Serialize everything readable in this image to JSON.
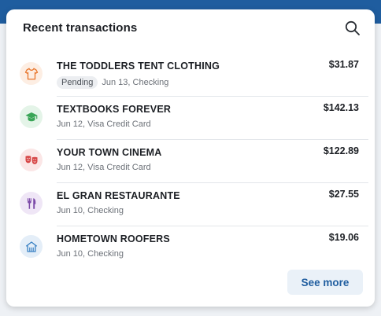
{
  "card": {
    "title": "Recent transactions"
  },
  "colors": {
    "header_band": "#1f5d9f",
    "accent": "#1f5d9f"
  },
  "transactions": [
    {
      "merchant": "THE TODDLERS TENT CLOTHING",
      "amount": "$31.87",
      "status": "Pending",
      "detail": "Jun 13, Checking",
      "icon": "tshirt-icon",
      "icon_color": "#e8772e",
      "icon_bg": "#fdeee3"
    },
    {
      "merchant": "TEXTBOOKS FOREVER",
      "amount": "$142.13",
      "detail": "Jun 12, Visa Credit Card",
      "icon": "graduation-cap-icon",
      "icon_color": "#3aa557",
      "icon_bg": "#e4f4e8"
    },
    {
      "merchant": "YOUR TOWN CINEMA",
      "amount": "$122.89",
      "detail": "Jun 12, Visa Credit Card",
      "icon": "theater-masks-icon",
      "icon_color": "#d64545",
      "icon_bg": "#fbe6e6"
    },
    {
      "merchant": "EL GRAN RESTAURANTE",
      "amount": "$27.55",
      "detail": "Jun 10, Checking",
      "icon": "utensils-icon",
      "icon_color": "#7c4aa8",
      "icon_bg": "#efe6f6"
    },
    {
      "merchant": "HOMETOWN ROOFERS",
      "amount": "$19.06",
      "detail": "Jun 10, Checking",
      "icon": "house-icon",
      "icon_color": "#3b82c4",
      "icon_bg": "#e4eef8"
    }
  ],
  "footer": {
    "see_more_label": "See more"
  }
}
